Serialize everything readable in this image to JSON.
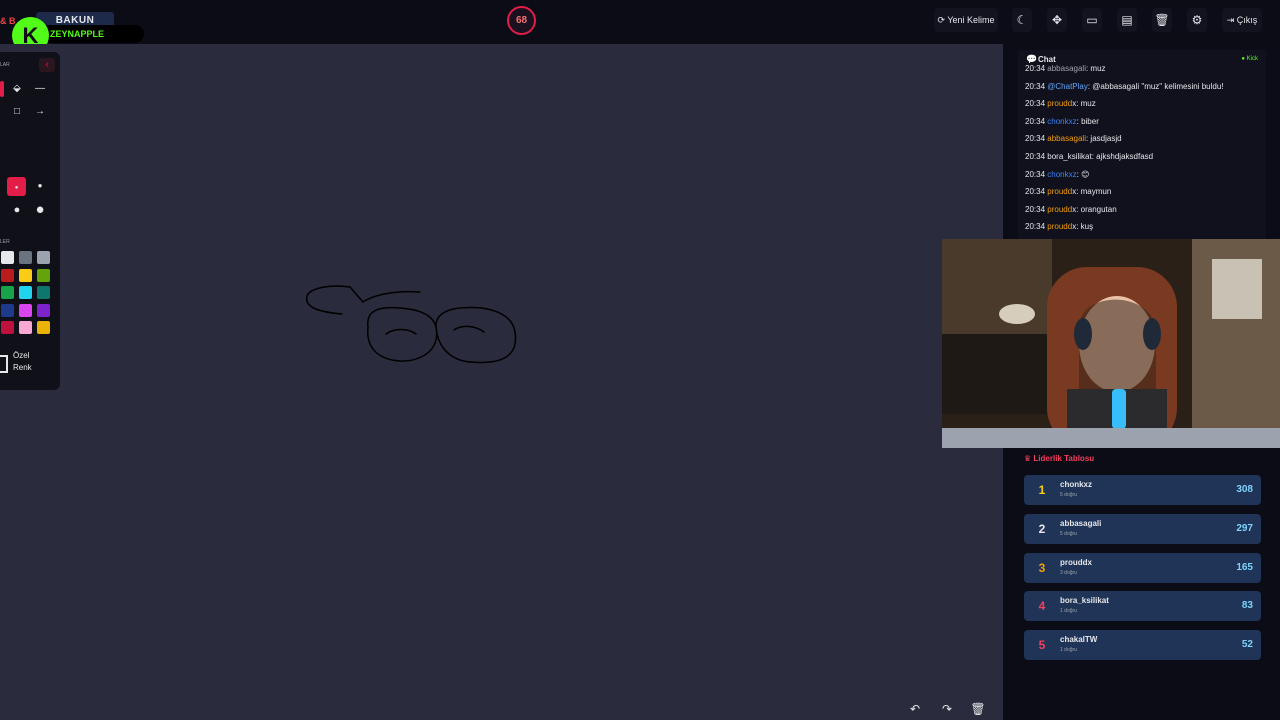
{
  "header": {
    "brand_partial": "& B",
    "secret_word": "BAKUN",
    "streamer": "ZEYNAPPLE",
    "kick_letter": "K",
    "timer": "68",
    "new_word_label": "Yeni Kelime",
    "logout_label": "Çıkış",
    "icons": [
      "moon-icon",
      "move-icon",
      "keyboard-icon",
      "archive-icon",
      "trash-icon",
      "gear-icon"
    ]
  },
  "tools": {
    "label_tools": "LAR",
    "label_colors": "LER",
    "custom_color": "Özel Renk",
    "swatches": [
      [
        "#e5e7eb",
        "#6b7280",
        "#9ca3af"
      ],
      [
        "#b91c1c",
        "#facc15",
        "#65a30d"
      ],
      [
        "#16a34a",
        "#22d3ee",
        "#0f766e"
      ],
      [
        "#1e3a8a",
        "#d946ef",
        "#7e22ce"
      ],
      [
        "#be123c",
        "#f9a8d4",
        "#eab308"
      ]
    ]
  },
  "chat": {
    "title": "Chat",
    "status": "Kick",
    "messages": [
      {
        "time": "20:34",
        "user": "abbasagali",
        "text": ": muz",
        "color": "#a1a1aa"
      },
      {
        "time": "20:34",
        "user": "@ChatPlay",
        "text": ": @abbasagali \"muz\" kelimesini buldu!",
        "color": "#60a5fa"
      },
      {
        "time": "20:34",
        "user": "proudd",
        "text": "x: muz",
        "color": "#f59e0b"
      },
      {
        "time": "20:34",
        "user": "chonkxz",
        "text": ": biber",
        "color": "#3b82f6"
      },
      {
        "time": "20:34",
        "user": "abbasagali",
        "text": ": jasdjasjd",
        "color": "#f59e0b"
      },
      {
        "time": "20:34",
        "user": "bora_ksilikat",
        "text": ": ajkshdjaksdfasd",
        "color": "#e5e7eb"
      },
      {
        "time": "20:34",
        "user": "chonkxz",
        "text": ": 😊",
        "color": "#3b82f6"
      },
      {
        "time": "20:34",
        "user": "proudd",
        "text": "x: maymun",
        "color": "#f59e0b"
      },
      {
        "time": "20:34",
        "user": "proudd",
        "text": "x: orangutan",
        "color": "#f59e0b"
      },
      {
        "time": "20:34",
        "user": "proudd",
        "text": "x: kuş",
        "color": "#f59e0b"
      }
    ]
  },
  "leaderboard": {
    "title": "Liderlik Tablosu",
    "rows": [
      {
        "rank": "1",
        "name": "chonkxz",
        "sub": "5 doğru",
        "score": "308",
        "rank_color": "#facc15"
      },
      {
        "rank": "2",
        "name": "abbasagali",
        "sub": "5 doğru",
        "score": "297",
        "rank_color": "#e5e7eb"
      },
      {
        "rank": "3",
        "name": "prouddx",
        "sub": "3 doğru",
        "score": "165",
        "rank_color": "#f59e0b"
      },
      {
        "rank": "4",
        "name": "bora_ksilikat",
        "sub": "1 doğru",
        "score": "83",
        "rank_color": "#f43f5e"
      },
      {
        "rank": "5",
        "name": "chakalTW",
        "sub": "1 doğru",
        "score": "52",
        "rank_color": "#f43f5e"
      }
    ]
  }
}
